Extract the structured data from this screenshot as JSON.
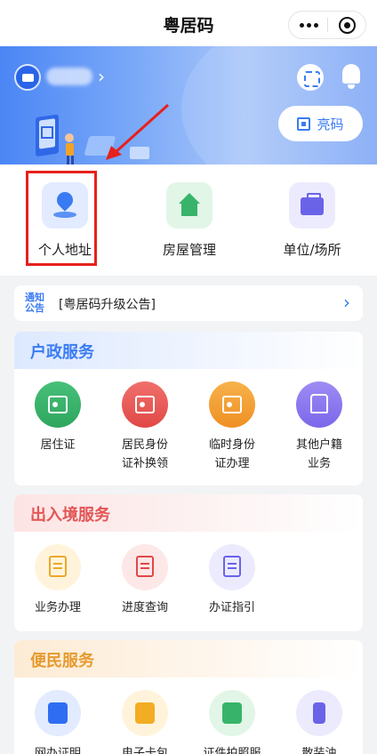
{
  "navbar": {
    "title": "粤居码",
    "more_icon": "more-dots-icon",
    "close_icon": "close-circle-icon"
  },
  "banner": {
    "light_button": "亮码",
    "scan_icon": "scan-icon",
    "bell_icon": "bell-icon"
  },
  "quick_actions": [
    {
      "label": "个人地址",
      "icon": "location-pin-icon"
    },
    {
      "label": "房屋管理",
      "icon": "house-icon"
    },
    {
      "label": "单位/场所",
      "icon": "briefcase-icon"
    }
  ],
  "notice": {
    "tag_line1": "通知",
    "tag_line2": "公告",
    "text": "[粤居码升级公告]"
  },
  "hz_service": {
    "title": "户政服务",
    "items": [
      {
        "line1": "居住证",
        "line2": ""
      },
      {
        "line1": "居民身份",
        "line2": "证补换领"
      },
      {
        "line1": "临时身份",
        "line2": "证办理"
      },
      {
        "line1": "其他户籍",
        "line2": "业务"
      }
    ]
  },
  "cr_service": {
    "title": "出入境服务",
    "items": [
      {
        "label": "业务办理"
      },
      {
        "label": "进度查询"
      },
      {
        "label": "办证指引"
      }
    ]
  },
  "bm_service": {
    "title": "便民服务",
    "items": [
      {
        "label": "网办证明"
      },
      {
        "label": "电子卡包"
      },
      {
        "label": "证件拍照服"
      },
      {
        "label": "散装油"
      }
    ]
  },
  "colors": {
    "brand_blue": "#3a7bf3",
    "highlight_red": "#e6201b"
  }
}
